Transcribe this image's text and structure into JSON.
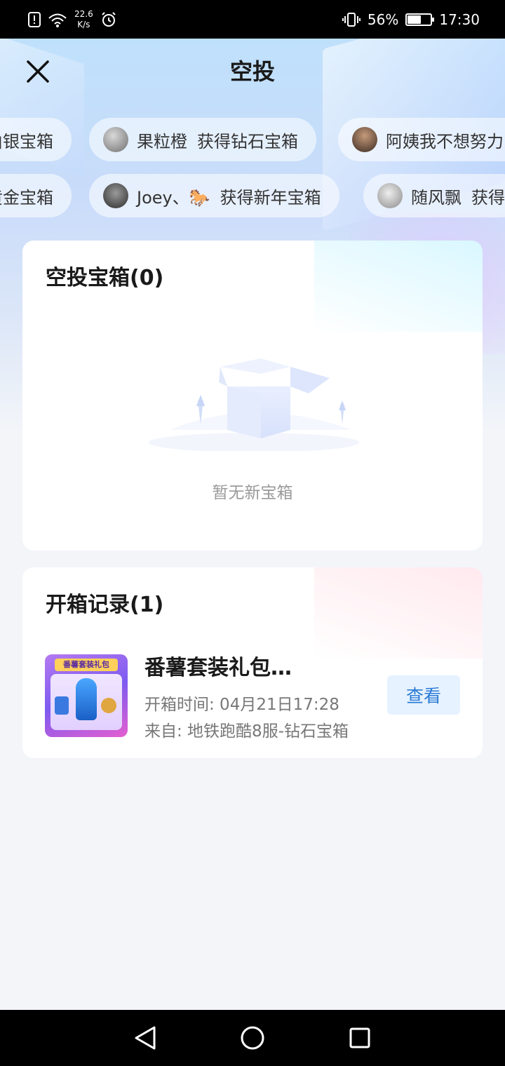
{
  "status_bar": {
    "speed_value": "22.6",
    "speed_unit": "K/s",
    "battery_percent": "56%",
    "battery_level": 0.56,
    "time": "17:30"
  },
  "header": {
    "title": "空投"
  },
  "ticker": {
    "row1": [
      {
        "user": "",
        "text": "由银宝箱"
      },
      {
        "user": "果粒橙",
        "text": "获得钻石宝箱"
      },
      {
        "user": "阿姨我不想努力",
        "text": ""
      }
    ],
    "row2": [
      {
        "user": "",
        "text": "黄金宝箱"
      },
      {
        "user": "Joey、🐎",
        "text": "获得新年宝箱"
      },
      {
        "user": "随风飘",
        "text": "获得"
      }
    ]
  },
  "airdrop": {
    "title": "空投宝箱(0)",
    "empty_text": "暂无新宝箱"
  },
  "records": {
    "title": "开箱记录(1)",
    "items": [
      {
        "name": "番薯套装礼包…",
        "time": "开箱时间: 04月21日17:28",
        "from": "来自: 地铁跑酷8服-钻石宝箱",
        "thumb_banner": "番薯套装礼包",
        "action": "查看"
      }
    ]
  }
}
